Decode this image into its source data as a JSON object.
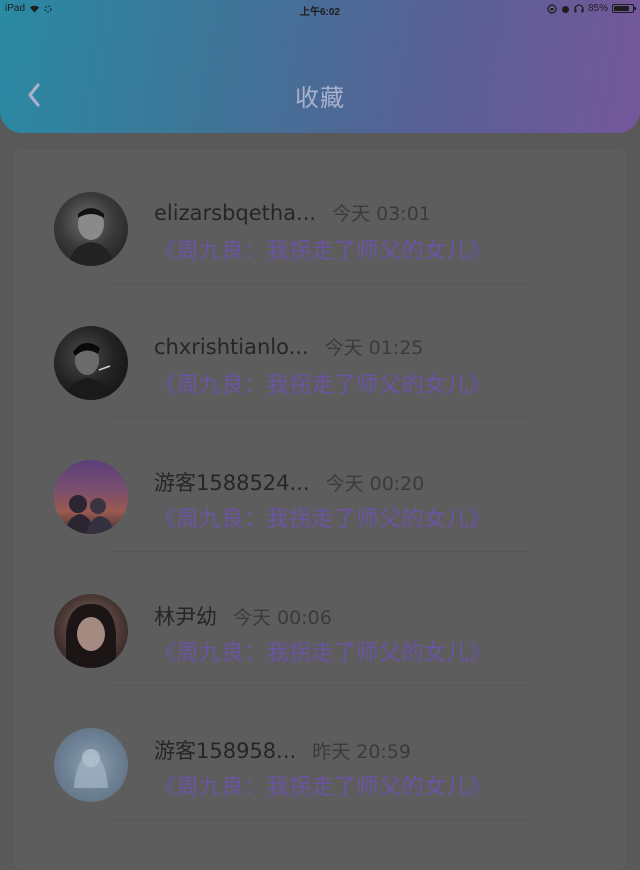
{
  "status_bar": {
    "device": "iPad",
    "time": "上午6:02",
    "battery": "85%",
    "battery_level": 0.85
  },
  "header": {
    "title": "收藏",
    "back_icon": "chevron-left-icon"
  },
  "favorites": [
    {
      "user": "elizarsbqetha...",
      "time": "今天 03:01",
      "book": "《周九良：我拐走了师父的女儿》"
    },
    {
      "user": "chxrishtianlo...",
      "time": "今天 01:25",
      "book": "《周九良：我拐走了师父的女儿》"
    },
    {
      "user": "游客1588524...",
      "time": "今天 00:20",
      "book": "《周九良：我拐走了师父的女儿》"
    },
    {
      "user": "林尹幼",
      "time": "今天 00:06",
      "book": "《周九良：我拐走了师父的女儿》"
    },
    {
      "user": "游客158958...",
      "time": "昨天 20:59",
      "book": "《周九良：我拐走了师父的女儿》"
    }
  ],
  "colors": {
    "header_gradient_start": "#2a8aa3",
    "header_gradient_end": "#74579a",
    "book_title": "#6a54a3",
    "overlay_background": "#595959"
  }
}
